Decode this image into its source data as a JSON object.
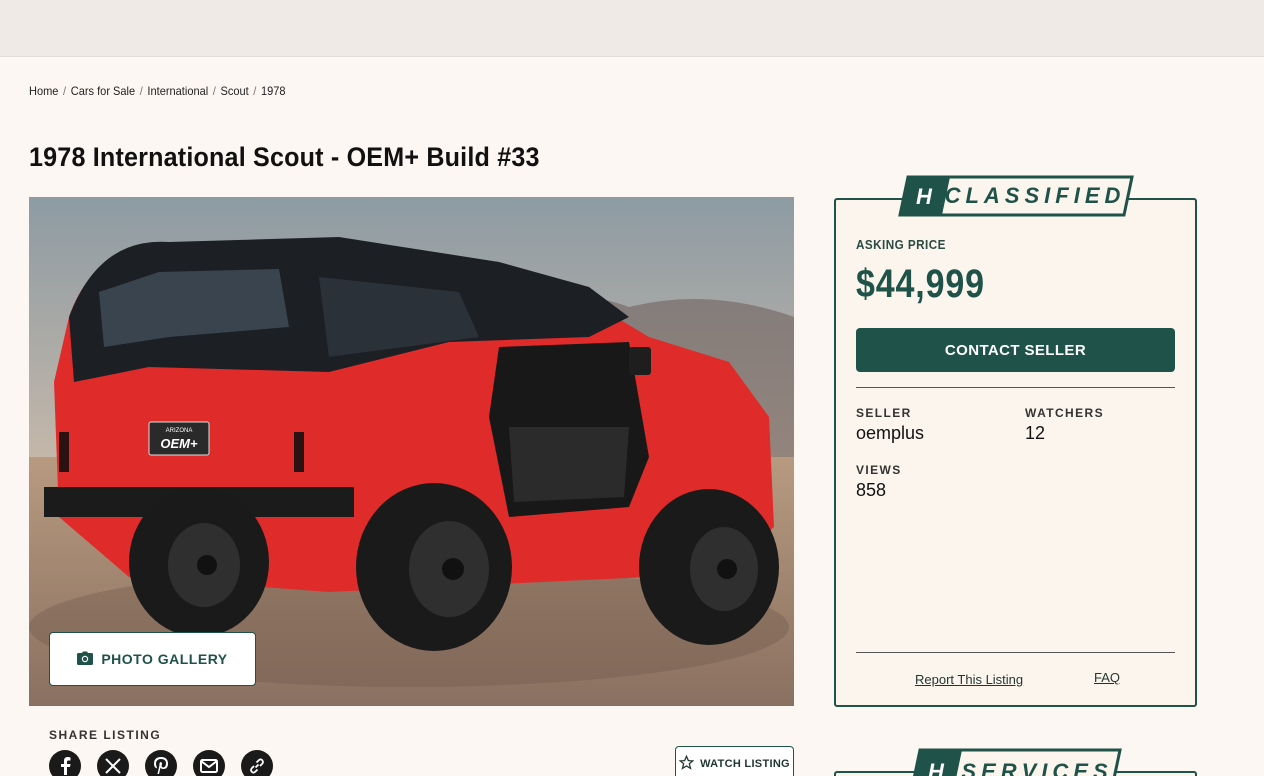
{
  "breadcrumb": [
    {
      "label": "Home"
    },
    {
      "label": "Cars for Sale"
    },
    {
      "label": "International"
    },
    {
      "label": "Scout"
    },
    {
      "label": "1978"
    }
  ],
  "listing": {
    "title": "1978 International Scout - OEM+ Build #33",
    "license_plate_state": "ARIZONA",
    "license_plate_text": "OEM+"
  },
  "gallery": {
    "button_label": "PHOTO GALLERY"
  },
  "share": {
    "label": "SHARE LISTING",
    "icons": [
      "facebook-icon",
      "x-icon",
      "pinterest-icon",
      "email-icon",
      "link-icon"
    ]
  },
  "watch": {
    "label": "WATCH LISTING"
  },
  "classified": {
    "banner_text": "CLASSIFIED",
    "asking_label": "ASKING PRICE",
    "price": "$44,999",
    "contact_label": "CONTACT SELLER",
    "seller_label": "SELLER",
    "seller_value": "oemplus",
    "watchers_label": "WATCHERS",
    "watchers_value": "12",
    "views_label": "VIEWS",
    "views_value": "858",
    "report_label": "Report This Listing",
    "faq_label": "FAQ"
  },
  "services": {
    "banner_text": "SERVICES"
  },
  "colors": {
    "brand_green": "#1f5248",
    "background": "#fcf7f2",
    "vehicle_red": "#e02b2b"
  }
}
